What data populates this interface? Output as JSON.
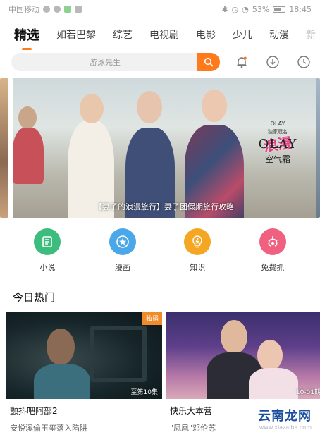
{
  "status_bar": {
    "carrier": "中国移动",
    "battery": "53%",
    "time": "18:45"
  },
  "tabs": [
    {
      "label": "精选",
      "active": true
    },
    {
      "label": "如若巴黎",
      "active": false
    },
    {
      "label": "综艺",
      "active": false
    },
    {
      "label": "电视剧",
      "active": false
    },
    {
      "label": "电影",
      "active": false
    },
    {
      "label": "少儿",
      "active": false
    },
    {
      "label": "动漫",
      "active": false
    },
    {
      "label": "新",
      "active": false
    }
  ],
  "search": {
    "placeholder": "游泳先生"
  },
  "top_icons": [
    "bell-icon",
    "download-icon",
    "history-icon"
  ],
  "banner": {
    "caption": "【妻子的浪漫旅行】妻子团假期旅行攻略",
    "brand_small": "OLAY",
    "sponsor_label": "独家冠名",
    "brand": "OLAY",
    "product": "空气霜"
  },
  "quick_entries": [
    {
      "label": "小说",
      "icon": "book-icon",
      "color": "#3dbd7d"
    },
    {
      "label": "漫画",
      "icon": "star-badge-icon",
      "color": "#4aa8e8"
    },
    {
      "label": "知识",
      "icon": "bulb-icon",
      "color": "#f5a623"
    },
    {
      "label": "免费抓",
      "icon": "claw-icon",
      "color": "#f0607f"
    }
  ],
  "section": {
    "title": "今日热门"
  },
  "cards": [
    {
      "title": "颤抖吧阿部2",
      "subtitle": "安悦溪偷玉玺落入陷阱",
      "badge": "独播",
      "episode": "至第10集"
    },
    {
      "title": "快乐大本营",
      "subtitle": "\"凤凰\"邓伦苏",
      "badge": "",
      "episode": "10-01期"
    }
  ],
  "watermark": {
    "main": "云南龙网",
    "url": "www.xiazaiba.com"
  },
  "colors": {
    "accent": "#ff7a1a"
  }
}
